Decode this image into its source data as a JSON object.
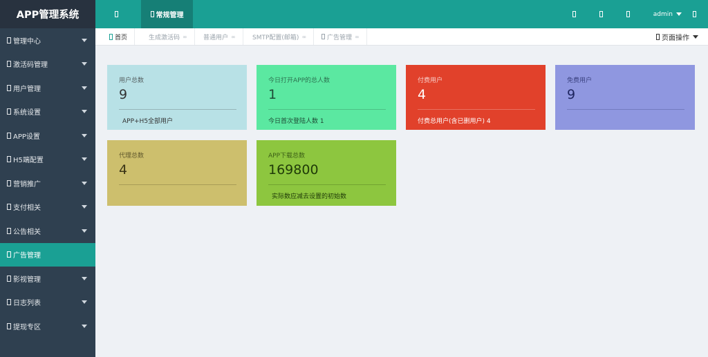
{
  "app_title": "APP管理系统",
  "sidebar": {
    "items": [
      {
        "label": "管理中心"
      },
      {
        "label": "激活码管理"
      },
      {
        "label": "用户管理"
      },
      {
        "label": "系统设置"
      },
      {
        "label": "APP设置"
      },
      {
        "label": "H5端配置"
      },
      {
        "label": "营销推广"
      },
      {
        "label": "支付相关"
      },
      {
        "label": "公告相关"
      },
      {
        "label": "广告管理"
      },
      {
        "label": "影视管理"
      },
      {
        "label": "日志列表"
      },
      {
        "label": "提现专区"
      }
    ],
    "active_index": 9
  },
  "header": {
    "tab_active_label": "常规管理",
    "user_label": "admin"
  },
  "tabbar": {
    "home_label": "首页",
    "tabs": [
      {
        "label": "生成激活码"
      },
      {
        "label": "普通用户"
      },
      {
        "label": "SMTP配置(邮箱)"
      },
      {
        "label": "广告管理"
      }
    ],
    "page_ops_label": "页面操作"
  },
  "cards": [
    {
      "title": "用户总数",
      "value": "9",
      "footer": "APP+H5全部用户",
      "bg": "#b8e1e6",
      "text_color": "#333333"
    },
    {
      "title": "今日打开APP的总人数",
      "value": "1",
      "footer": "今日首次登陆人数  1",
      "bg": "#5be8a1",
      "text_color": "#1e4a35"
    },
    {
      "title": "付费用户",
      "value": "4",
      "footer": "付费总用户(含已删用户)  4",
      "bg": "#e1412b",
      "text_color": "#ffffff"
    },
    {
      "title": "免费用户",
      "value": "9",
      "footer": "",
      "bg": "#8f97e0",
      "text_color": "#1f2660"
    },
    {
      "title": "代理总数",
      "value": "4",
      "footer": "",
      "bg": "#cdbf6d",
      "text_color": "#3a3416"
    },
    {
      "title": "APP下载总数",
      "value": "169800",
      "footer": "实际数应减去设置的初始数",
      "bg": "#8dc63f",
      "text_color": "#1f3a08"
    }
  ],
  "colors": {
    "sidebar_bg": "#2f4050",
    "accent": "#1aa094",
    "content_bg": "#eef1f5"
  }
}
